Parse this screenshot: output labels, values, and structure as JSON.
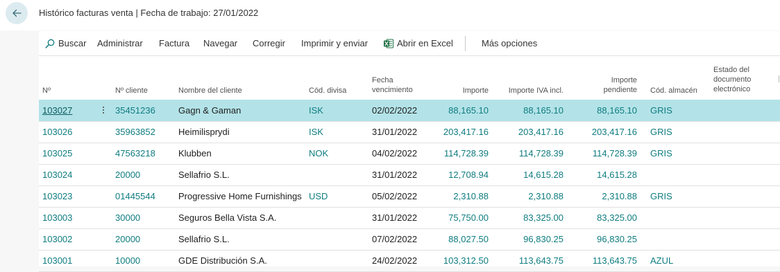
{
  "header": {
    "title": "Histórico facturas venta | Fecha de trabajo: 27/01/2022"
  },
  "actions": {
    "search": "Buscar",
    "manage": "Administrar",
    "invoice": "Factura",
    "navigate": "Navegar",
    "correct": "Corregir",
    "print": "Imprimir y enviar",
    "excel": "Abrir en Excel",
    "more": "Más opciones"
  },
  "table": {
    "headers": {
      "no": "Nº",
      "customer_no": "Nº cliente",
      "customer_name": "Nombre del cliente",
      "currency": "Cód. divisa",
      "due_date_1": "Fecha",
      "due_date_2": "vencimiento",
      "amount": "Importe",
      "amount_vat": "Importe IVA incl.",
      "remaining_1": "Importe",
      "remaining_2": "pendiente",
      "location": "Cód. almacén",
      "edoc_1": "Estado del",
      "edoc_2": "documento",
      "edoc_3": "electrónico"
    },
    "rows": [
      {
        "no": "103027",
        "customer_no": "35451236",
        "name": "Gagn & Gaman",
        "currency": "ISK",
        "due": "02/02/2022",
        "amount": "88,165.10",
        "amount_vat": "88,165.10",
        "remaining": "88,165.10",
        "location": "GRIS"
      },
      {
        "no": "103026",
        "customer_no": "35963852",
        "name": "Heimilisprydi",
        "currency": "ISK",
        "due": "31/01/2022",
        "amount": "203,417.16",
        "amount_vat": "203,417.16",
        "remaining": "203,417.16",
        "location": "GRIS"
      },
      {
        "no": "103025",
        "customer_no": "47563218",
        "name": "Klubben",
        "currency": "NOK",
        "due": "04/02/2022",
        "amount": "114,728.39",
        "amount_vat": "114,728.39",
        "remaining": "114,728.39",
        "location": "GRIS"
      },
      {
        "no": "103024",
        "customer_no": "20000",
        "name": "Sellafrio S.L.",
        "currency": "",
        "due": "31/01/2022",
        "amount": "12,708.94",
        "amount_vat": "14,615.28",
        "remaining": "14,615.28",
        "location": ""
      },
      {
        "no": "103023",
        "customer_no": "01445544",
        "name": "Progressive Home Furnishings",
        "currency": "USD",
        "due": "05/02/2022",
        "amount": "2,310.88",
        "amount_vat": "2,310.88",
        "remaining": "2,310.88",
        "location": "GRIS"
      },
      {
        "no": "103003",
        "customer_no": "30000",
        "name": "Seguros Bella Vista S.A.",
        "currency": "",
        "due": "31/01/2022",
        "amount": "75,750.00",
        "amount_vat": "83,325.00",
        "remaining": "83,325.00",
        "location": ""
      },
      {
        "no": "103002",
        "customer_no": "20000",
        "name": "Sellafrio S.L.",
        "currency": "",
        "due": "07/02/2022",
        "amount": "88,027.50",
        "amount_vat": "96,830.25",
        "remaining": "96,830.25",
        "location": ""
      },
      {
        "no": "103001",
        "customer_no": "10000",
        "name": "GDE Distribución S.A.",
        "currency": "",
        "due": "24/02/2022",
        "amount": "103,312.50",
        "amount_vat": "113,643.75",
        "remaining": "113,643.75",
        "location": "AZUL"
      }
    ]
  },
  "colors": {
    "accent": "#0f7c80",
    "selected_row": "#b3e3e8",
    "excel_green": "#1e7145"
  },
  "icons": {
    "back": "arrow-left-icon",
    "search": "search-icon",
    "excel": "excel-icon",
    "row_menu": "more-vertical-icon"
  }
}
